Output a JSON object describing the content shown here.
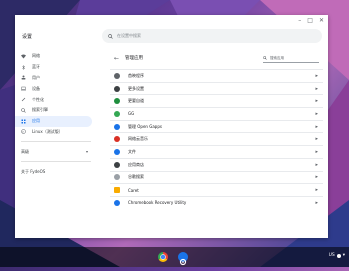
{
  "window": {
    "title": "设置",
    "controls": [
      "–",
      "□",
      "✕"
    ]
  },
  "search": {
    "placeholder": "在设置中搜索"
  },
  "sidebar": {
    "items": [
      {
        "label": "网络",
        "icon": "wifi-icon"
      },
      {
        "label": "蓝牙",
        "icon": "bluetooth-icon"
      },
      {
        "label": "用户",
        "icon": "people-icon"
      },
      {
        "label": "设备",
        "icon": "laptop-icon"
      },
      {
        "label": "个性化",
        "icon": "brush-icon"
      },
      {
        "label": "搜索引擎",
        "icon": "search-icon"
      },
      {
        "label": "应用",
        "icon": "apps-grid-icon",
        "active": true
      },
      {
        "label": "Linux（测试版）",
        "icon": "terminal-icon"
      }
    ],
    "advanced": "高级",
    "about": "关于 FydeOS"
  },
  "main": {
    "back_label": "←",
    "title": "管理应用",
    "search_placeholder": "搜索应用",
    "apps": [
      {
        "name": "首映程序",
        "color": "#5f6368"
      },
      {
        "name": "更多设置",
        "color": "#3c4043"
      },
      {
        "name": "更要自道",
        "color": "#1e8e3e"
      },
      {
        "name": "GG",
        "color": "#34a853"
      },
      {
        "name": "管理 Open Gapps",
        "color": "#1a73e8"
      },
      {
        "name": "网络云音乐",
        "color": "#d93025"
      },
      {
        "name": "文件",
        "color": "#1a73e8"
      },
      {
        "name": "应用商店",
        "color": "#3c4043"
      },
      {
        "name": "谷歌搜索",
        "color": "#9aa0a6"
      },
      {
        "name": "Caret",
        "color": "#f9ab00"
      },
      {
        "name": "Chromebook Recovery Utility",
        "color": "#1a73e8"
      }
    ]
  },
  "shelf": {
    "locale": "US"
  }
}
